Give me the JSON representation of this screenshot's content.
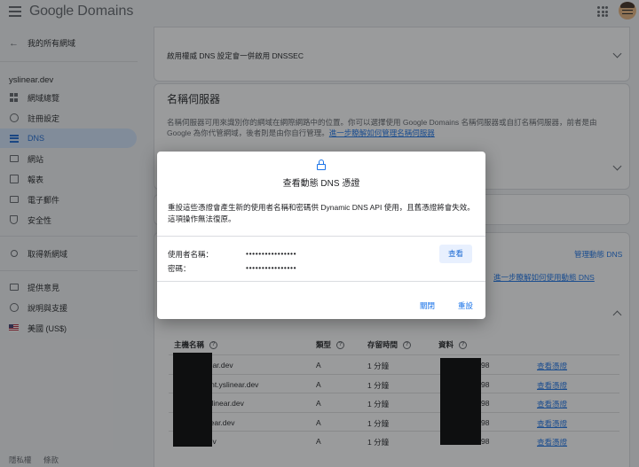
{
  "header": {
    "logo_google": "Google",
    "logo_domains": "Domains"
  },
  "sidebar": {
    "back_label": "我的所有網域",
    "domain": "yslinear.dev",
    "items": [
      {
        "label": "網域總覽",
        "icon": "dashboard-icon"
      },
      {
        "label": "註冊設定",
        "icon": "settings-icon"
      },
      {
        "label": "DNS",
        "icon": "dns-icon",
        "active": true
      },
      {
        "label": "網站",
        "icon": "website-icon"
      },
      {
        "label": "報表",
        "icon": "reports-icon"
      },
      {
        "label": "電子郵件",
        "icon": "email-icon"
      },
      {
        "label": "安全性",
        "icon": "security-icon"
      }
    ],
    "search_label": "取得新網域",
    "feedback_label": "提供意見",
    "help_label": "說明與支援",
    "currency_label": "美國 (US$)",
    "privacy_label": "隱私權",
    "terms_label": "條款"
  },
  "main": {
    "dnssec_text": "啟用權威 DNS 設定會一併啟用 DNSSEC",
    "ns_title": "名稱伺服器",
    "ns_desc": "名稱伺服器可用來識別你的網域在網際網路中的位置。你可以選擇使用 Google Domains 名稱伺服器或自訂名稱伺服器，前者是由 Google 為你代管網域，後者則是由你自行管理。",
    "ns_link": "進一步瞭解如何管理名稱伺服器",
    "manage_ddns": "管理動態 DNS",
    "ddns_learn": "進一步瞭解如何使用動態 DNS",
    "table": {
      "headers": [
        "主機名稱",
        "類型",
        "存留時間",
        "資料"
      ],
      "rows": [
        {
          "host": "near.dev",
          "type": "A",
          "ttl": "1 分鐘",
          "data": "98",
          "action": "查看憑證"
        },
        {
          "host": "tant.yslinear.dev",
          "type": "A",
          "ttl": "1 分鐘",
          "data": "98",
          "action": "查看憑證"
        },
        {
          "host": "yslinear.dev",
          "type": "A",
          "ttl": "1 分鐘",
          "data": "98",
          "action": "查看憑證"
        },
        {
          "host": "inear.dev",
          "type": "A",
          "ttl": "1 分鐘",
          "data": "98",
          "action": "查看憑證"
        },
        {
          "host": "dev",
          "type": "A",
          "ttl": "1 分鐘",
          "data": "98",
          "action": "查看憑證"
        }
      ]
    }
  },
  "dialog": {
    "title": "查看動態 DNS 憑證",
    "description": "重設這些憑證會產生新的使用者名稱和密碼供 Dynamic DNS API 使用，且舊憑證將會失效。這項操作無法復原。",
    "username_label": "使用者名稱：",
    "username_value": "••••••••••••••••",
    "password_label": "密碼：",
    "password_value": "••••••••••••••••",
    "view_button": "查看",
    "close_button": "關閉",
    "reset_button": "重設"
  }
}
